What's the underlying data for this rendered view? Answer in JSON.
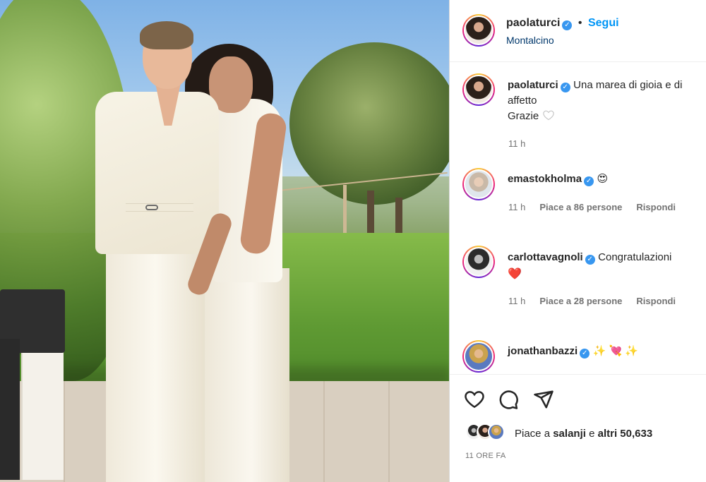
{
  "post": {
    "author": "paolaturci",
    "follow_label": "Segui",
    "location": "Montalcino",
    "caption_line1": "Una marea di gioia e di",
    "caption_line2": "affetto",
    "caption_line3": "Grazie",
    "caption_time": "11 h"
  },
  "comments": [
    {
      "user": "emastokholma",
      "text": "😍",
      "time": "11 h",
      "likes": "Piace a 86 persone",
      "reply": "Rispondi"
    },
    {
      "user": "carlottavagnoli",
      "text": "Congratulazioni",
      "text2": "❤️",
      "time": "11 h",
      "likes": "Piace a 28 persone",
      "reply": "Rispondi"
    },
    {
      "user": "jonathanbazzi",
      "text": "✨ 💘 ✨"
    }
  ],
  "footer": {
    "likes_prefix": "Piace a",
    "likes_user": "salanji",
    "likes_mid": "e",
    "likes_others": "altri 50,633",
    "timestamp": "11 ORE FA"
  },
  "icons": [
    "heart-icon",
    "comment-icon",
    "share-icon",
    "verified-icon"
  ],
  "colors": {
    "accent": "#0095f6",
    "verified": "#3897f0",
    "heart": "#ed4956"
  }
}
